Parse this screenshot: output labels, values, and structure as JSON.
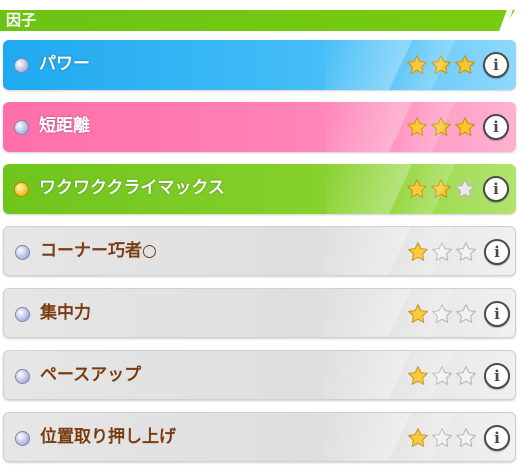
{
  "header": {
    "title": "因子"
  },
  "factors": [
    {
      "name": "パワー",
      "stars": 3,
      "max_stars": 3,
      "theme": "blue",
      "gem": "silver"
    },
    {
      "name": "短距離",
      "stars": 3,
      "max_stars": 3,
      "theme": "pink",
      "gem": "silver"
    },
    {
      "name": "ワクワククライマックス",
      "stars": 2,
      "max_stars": 3,
      "theme": "green",
      "gem": "gold"
    },
    {
      "name": "コーナー巧者○",
      "stars": 1,
      "max_stars": 3,
      "theme": "white",
      "gem": "silver"
    },
    {
      "name": "集中力",
      "stars": 1,
      "max_stars": 3,
      "theme": "white",
      "gem": "silver"
    },
    {
      "name": "ペースアップ",
      "stars": 1,
      "max_stars": 3,
      "theme": "white",
      "gem": "silver"
    },
    {
      "name": "位置取り押し上げ",
      "stars": 1,
      "max_stars": 3,
      "theme": "white",
      "gem": "silver"
    }
  ],
  "info_button_glyph": "i",
  "icons": {
    "gem": "gem-icon",
    "star": "star-icon",
    "info": "info-icon"
  },
  "colors": {
    "header": "#78cc10",
    "blue": "#1fa9f0",
    "pink": "#ff6fa9",
    "green": "#6ec51c",
    "white": "#e3e3e3",
    "star_filled": "#f7c72a",
    "label_dark": "#7a3d12"
  }
}
